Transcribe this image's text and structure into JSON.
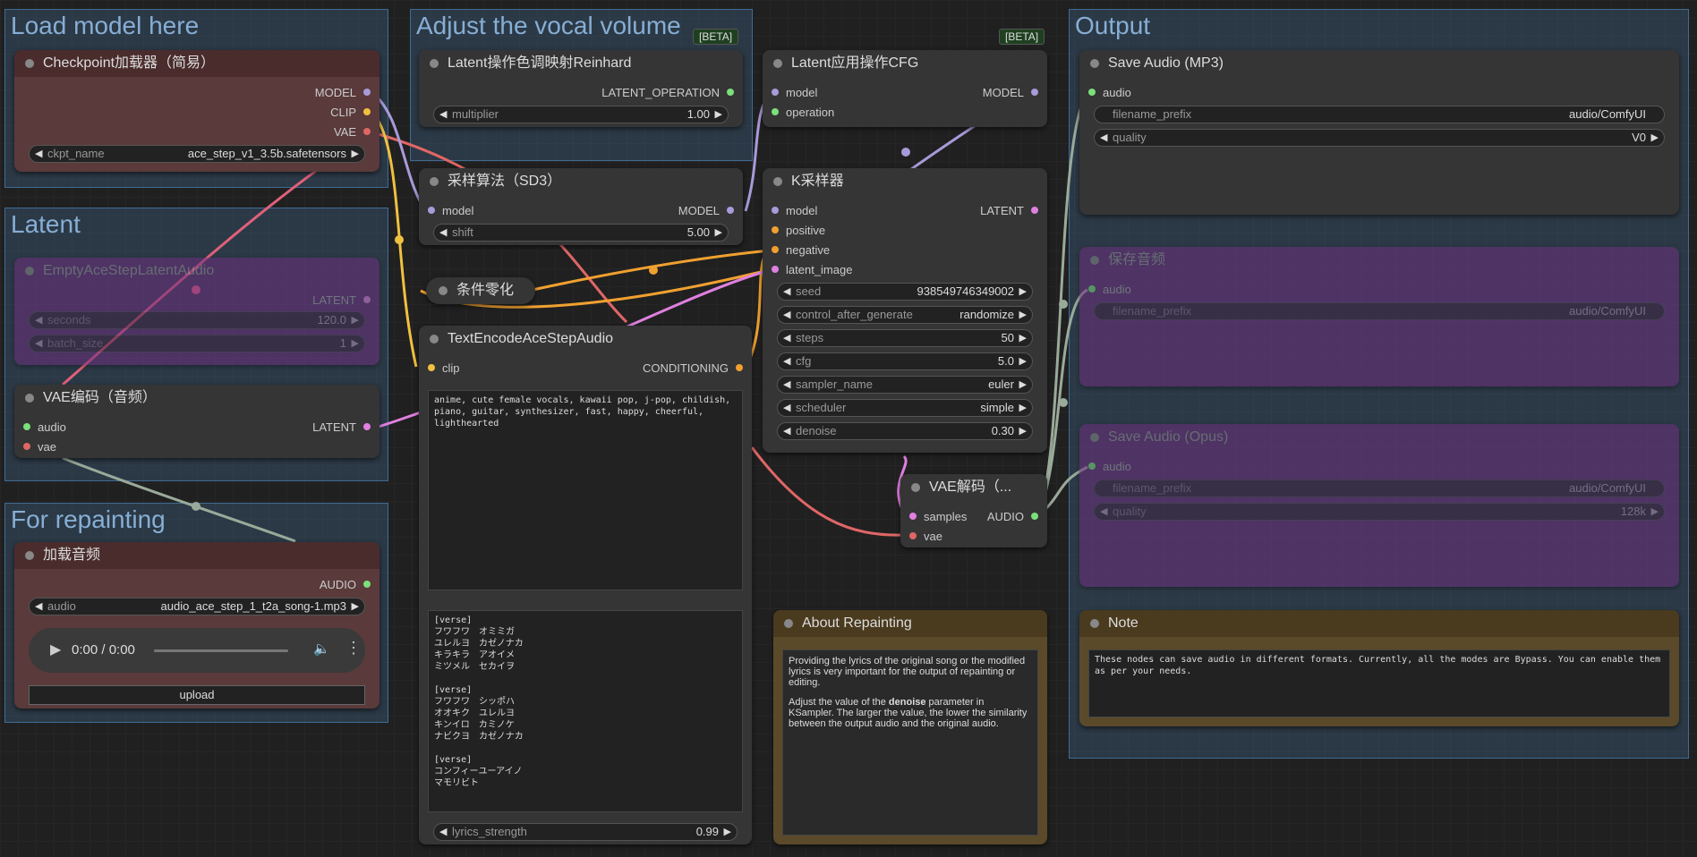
{
  "groups": {
    "load": "Load model here",
    "latent": "Latent",
    "repaint": "For repainting",
    "vocal": "Adjust the vocal volume",
    "output": "Output"
  },
  "badges": {
    "b1": "[BETA]",
    "b2": "[BETA]"
  },
  "checkpoint": {
    "title": "Checkpoint加载器（简易）",
    "out_model": "MODEL",
    "out_clip": "CLIP",
    "out_vae": "VAE",
    "ckpt_label": "ckpt_name",
    "ckpt_value": "ace_step_v1_3.5b.safetensors"
  },
  "empty_latent": {
    "title": "EmptyAceStepLatentAudio",
    "out": "LATENT",
    "seconds_label": "seconds",
    "seconds_value": "120.0",
    "batch_label": "batch_size",
    "batch_value": "1"
  },
  "vae_encode": {
    "title": "VAE编码（音频）",
    "in_audio": "audio",
    "in_vae": "vae",
    "out": "LATENT"
  },
  "load_audio": {
    "title": "加载音频",
    "out": "AUDIO",
    "audio_label": "audio",
    "audio_value": "audio_ace_step_1_t2a_song-1.mp3",
    "time": "0:00 / 0:00",
    "upload": "upload"
  },
  "reinhard": {
    "title": "Latent操作色调映射Reinhard",
    "out": "LATENT_OPERATION",
    "mult_label": "multiplier",
    "mult_value": "1.00"
  },
  "sd3": {
    "title": "采样算法（SD3）",
    "in_model": "model",
    "out": "MODEL",
    "shift_label": "shift",
    "shift_value": "5.00"
  },
  "zero": {
    "title": "条件零化"
  },
  "textenc": {
    "title": "TextEncodeAceStepAudio",
    "in_clip": "clip",
    "out": "CONDITIONING",
    "tags": "anime, cute female vocals, kawaii pop, j-pop, childish, piano, guitar, synthesizer, fast, happy, cheerful, lighthearted",
    "lyrics": "[verse]\nフワフワ　オミミガ\nユレルヨ　カゼノナカ\nキラキラ　アオイメ\nミツメル　セカイヲ\n\n[verse]\nフワフワ　シッポハ\nオオキク　ユレルヨ\nキンイロ　カミノケ\nナビクヨ　カゼノナカ\n\n[verse]\nコンフィーユーアイノ\nマモリビト",
    "ls_label": "lyrics_strength",
    "ls_value": "0.99"
  },
  "cfg": {
    "title": "Latent应用操作CFG",
    "in_model": "model",
    "in_op": "operation",
    "out": "MODEL"
  },
  "ksampler": {
    "title": "K采样器",
    "in_model": "model",
    "in_pos": "positive",
    "in_neg": "negative",
    "in_latent": "latent_image",
    "out": "LATENT",
    "w": [
      {
        "l": "seed",
        "v": "938549746349002"
      },
      {
        "l": "control_after_generate",
        "v": "randomize"
      },
      {
        "l": "steps",
        "v": "50"
      },
      {
        "l": "cfg",
        "v": "5.0"
      },
      {
        "l": "sampler_name",
        "v": "euler"
      },
      {
        "l": "scheduler",
        "v": "simple"
      },
      {
        "l": "denoise",
        "v": "0.30"
      }
    ]
  },
  "vae_decode": {
    "title": "VAE解码（...",
    "in_samples": "samples",
    "in_vae": "vae",
    "out": "AUDIO"
  },
  "about": {
    "title": "About Repainting",
    "p1": "Providing the lyrics of the original song or the modified lyrics is very important for the output of repainting or editing.",
    "p2a": "Adjust the value of the ",
    "p2b": "denoise",
    "p2c": " parameter in KSampler. The larger the value, the lower the similarity between the output audio and the original audio."
  },
  "save_mp3": {
    "title": "Save Audio (MP3)",
    "in_audio": "audio",
    "fn_label": "filename_prefix",
    "fn_value": "audio/ComfyUI",
    "q_label": "quality",
    "q_value": "V0"
  },
  "save_audio": {
    "title": "保存音频",
    "in_audio": "audio",
    "fn_label": "filename_prefix",
    "fn_value": "audio/ComfyUI"
  },
  "save_opus": {
    "title": "Save Audio (Opus)",
    "in_audio": "audio",
    "fn_label": "filename_prefix",
    "fn_value": "audio/ComfyUI",
    "q_label": "quality",
    "q_value": "128k"
  },
  "note": {
    "title": "Note",
    "text": "These nodes can save audio in different formats. Currently, all the modes are Bypass. You can enable them as per your needs."
  }
}
